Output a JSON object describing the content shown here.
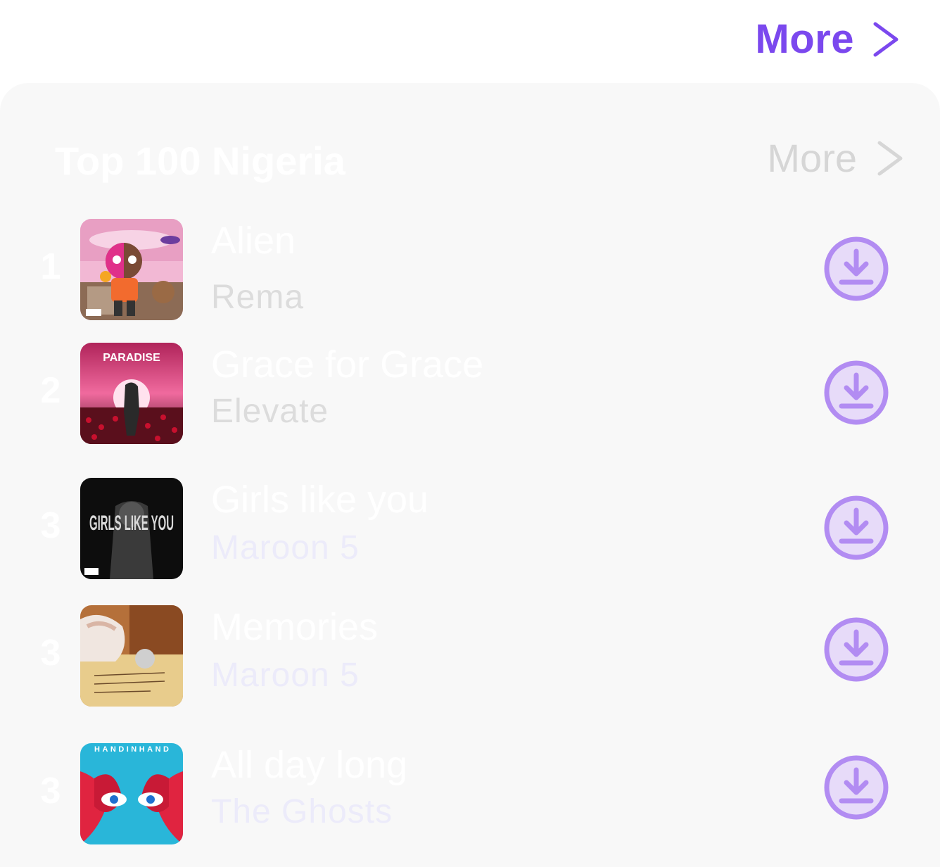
{
  "header": {
    "more_label": "More"
  },
  "section": {
    "title": "Top 100 Nigeria",
    "more_label": "More"
  },
  "tracks": [
    {
      "rank": "1",
      "title": "Alien",
      "artist": "Rema"
    },
    {
      "rank": "2",
      "title": "Grace for Grace",
      "artist": "Elevate"
    },
    {
      "rank": "3",
      "title": "Girls like you",
      "artist": "Maroon 5"
    },
    {
      "rank": "3",
      "title": "Memories",
      "artist": "Maroon 5"
    },
    {
      "rank": "3",
      "title": "All day long",
      "artist": "The Ghosts"
    }
  ],
  "artwork": [
    {
      "text": ""
    },
    {
      "text": "PARADISE"
    },
    {
      "text": "GIRLS LIKE YOU"
    },
    {
      "text": ""
    },
    {
      "text": "HANDINHAND"
    }
  ],
  "colors": {
    "accent": "#7b48ee",
    "download_ring": "#b28cf2",
    "download_fill": "#e7dbf9",
    "card_bg": "#f8f8f8",
    "muted_more": "#d6d6d6",
    "artist_gray": "#dcdcdc",
    "artist_lavender": "#ecebfa"
  },
  "icons": {
    "more_chevron": "chevron-right-icon",
    "download": "download-circle-icon"
  }
}
